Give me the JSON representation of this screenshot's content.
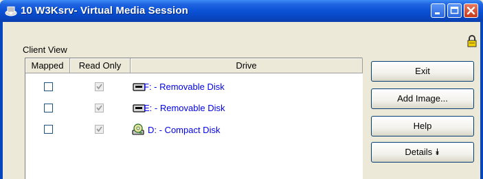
{
  "window": {
    "title": "10 W3Ksrv- Virtual Media Session"
  },
  "client_view": {
    "label": "Client View",
    "columns": [
      "Mapped",
      "Read Only",
      "Drive"
    ],
    "rows": [
      {
        "mapped": false,
        "read_only": true,
        "drive_icon": "removable-disk-icon",
        "drive": "F: - Removable Disk"
      },
      {
        "mapped": false,
        "read_only": true,
        "drive_icon": "removable-disk-icon",
        "drive": "E: - Removable Disk"
      },
      {
        "mapped": false,
        "read_only": true,
        "drive_icon": "compact-disk-icon",
        "drive": "D: - Compact Disk"
      }
    ]
  },
  "buttons": {
    "exit": "Exit",
    "add_image": "Add Image...",
    "help": "Help",
    "details": "Details ⯯"
  },
  "icons": {
    "app": "virtual-media-icon",
    "lock": "lock-icon",
    "minimize": "minimize-icon",
    "maximize": "maximize-icon",
    "close": "close-icon"
  },
  "colors": {
    "titlebar": "#0a52d6",
    "window_bg": "#ece9d8",
    "link_text": "#0000ee",
    "close_button": "#c8391a"
  }
}
